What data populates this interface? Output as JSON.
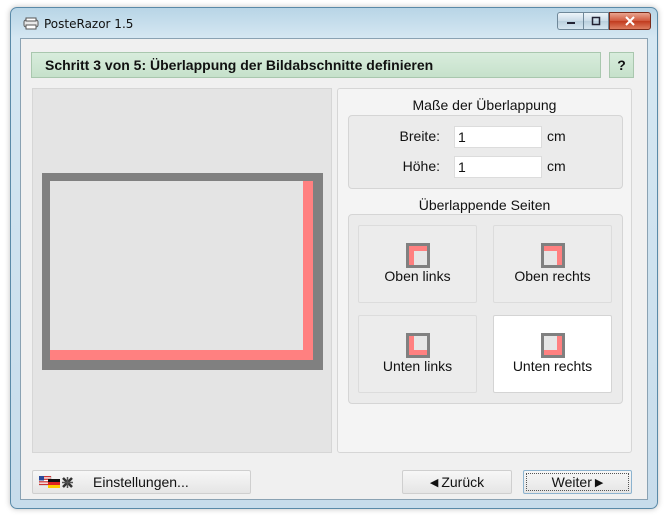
{
  "window": {
    "title": "PosteRazor 1.5"
  },
  "colors": {
    "overlap": "#ff8080",
    "frame": "#808080",
    "header_bg": "#c6e1cb"
  },
  "header": {
    "step_title": "Schritt 3 von 5: Überlappung der Bildabschnitte definieren",
    "help_label": "?"
  },
  "overlap_size": {
    "title": "Maße der Überlappung",
    "width_label": "Breite:",
    "width_value": "1",
    "width_unit": "cm",
    "height_label": "Höhe:",
    "height_value": "1",
    "height_unit": "cm"
  },
  "overlapping_sides": {
    "title": "Überlappende Seiten",
    "options": [
      {
        "label": "Oben links",
        "selected": false
      },
      {
        "label": "Oben rechts",
        "selected": false
      },
      {
        "label": "Unten links",
        "selected": false
      },
      {
        "label": "Unten rechts",
        "selected": true
      }
    ]
  },
  "footer": {
    "settings_label": "Einstellungen...",
    "back_label": "Zurück",
    "next_label": "Weiter"
  }
}
